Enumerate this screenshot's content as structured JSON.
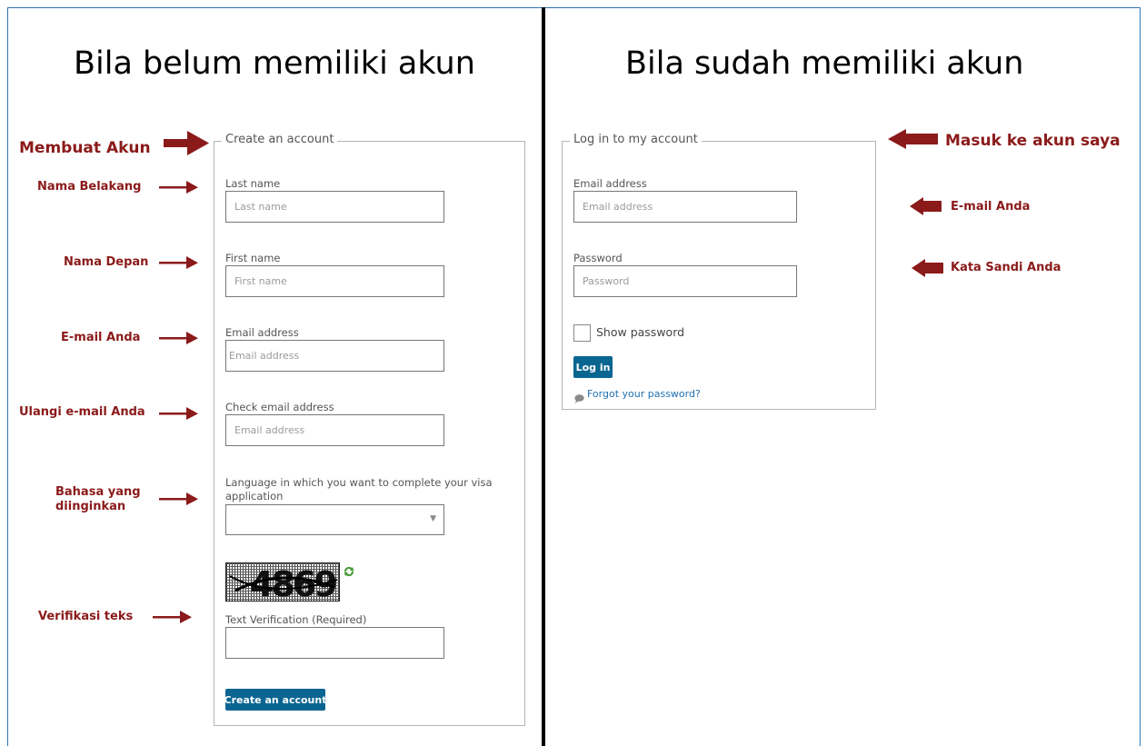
{
  "colors": {
    "frame_border": "#2e75b6",
    "annotation": "#8b1a1a",
    "button": "#0b6591",
    "link": "#1f6fb0"
  },
  "headings": {
    "left": "Bila belum memiliki akun",
    "right": "Bila sudah memiliki akun"
  },
  "create_account": {
    "legend": "Create an account",
    "last_name": {
      "label": "Last name",
      "placeholder": "Last name",
      "value": ""
    },
    "first_name": {
      "label": "First name",
      "placeholder": "First name",
      "value": ""
    },
    "email": {
      "label": "Email address",
      "placeholder": "Email address",
      "value": ""
    },
    "check_email": {
      "label": "Check email address",
      "placeholder": "Email address",
      "value": ""
    },
    "language": {
      "label": "Language in which you want to complete your visa application",
      "selected": ""
    },
    "captcha_text": "4869",
    "text_verification": {
      "label": "Text Verification (Required)",
      "value": ""
    },
    "submit_label": "Create an account"
  },
  "login": {
    "legend": "Log in to my account",
    "email": {
      "label": "Email address",
      "placeholder": "Email address",
      "value": ""
    },
    "password": {
      "label": "Password",
      "placeholder": "Password",
      "value": ""
    },
    "show_password_label": "Show password",
    "login_label": "Log in",
    "forgot_label": "Forgot your password?"
  },
  "annotations": {
    "create_account": "Membuat Akun",
    "last_name": "Nama Belakang",
    "first_name": "Nama Depan",
    "email": "E-mail Anda",
    "check_email": "Ulangi e-mail Anda",
    "language": "Bahasa yang diinginkan",
    "captcha": "Verifikasi teks",
    "login_account": "Masuk ke akun saya",
    "login_email": "E-mail Anda",
    "login_password": "Kata Sandi Anda"
  }
}
